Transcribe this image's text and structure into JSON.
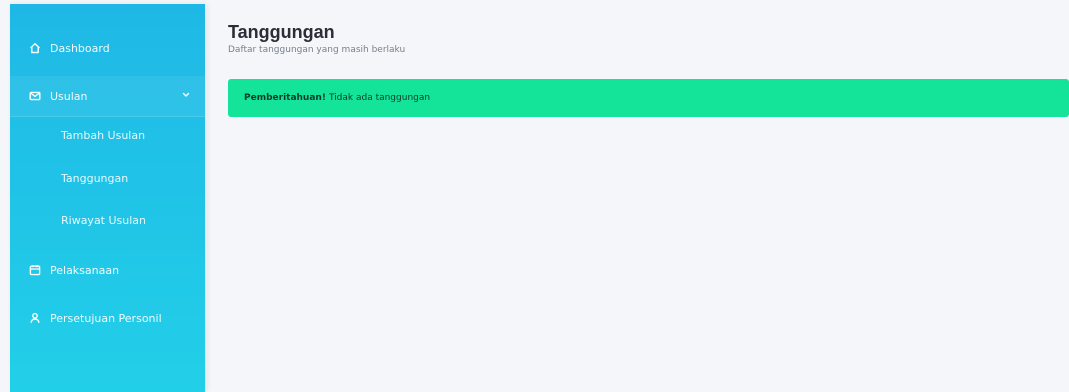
{
  "sidebar": {
    "items": [
      {
        "label": "Dashboard",
        "icon": "home-icon"
      },
      {
        "label": "Usulan",
        "icon": "mail-icon",
        "expanded": true
      },
      {
        "label": "Pelaksanaan",
        "icon": "calendar-icon"
      },
      {
        "label": "Persetujuan Personil",
        "icon": "user-icon"
      }
    ],
    "subitems": [
      {
        "label": "Tambah Usulan"
      },
      {
        "label": "Tanggungan"
      },
      {
        "label": "Riwayat Usulan"
      }
    ],
    "gradient_top": "#1fb8e6",
    "gradient_bottom": "#22cfe8"
  },
  "page": {
    "title": "Tanggungan",
    "subtitle": "Daftar tanggungan yang masih berlaku"
  },
  "alert": {
    "strong": "Pemberitahuan!",
    "message": "Tidak ada tanggungan",
    "color": "#14e39a"
  }
}
